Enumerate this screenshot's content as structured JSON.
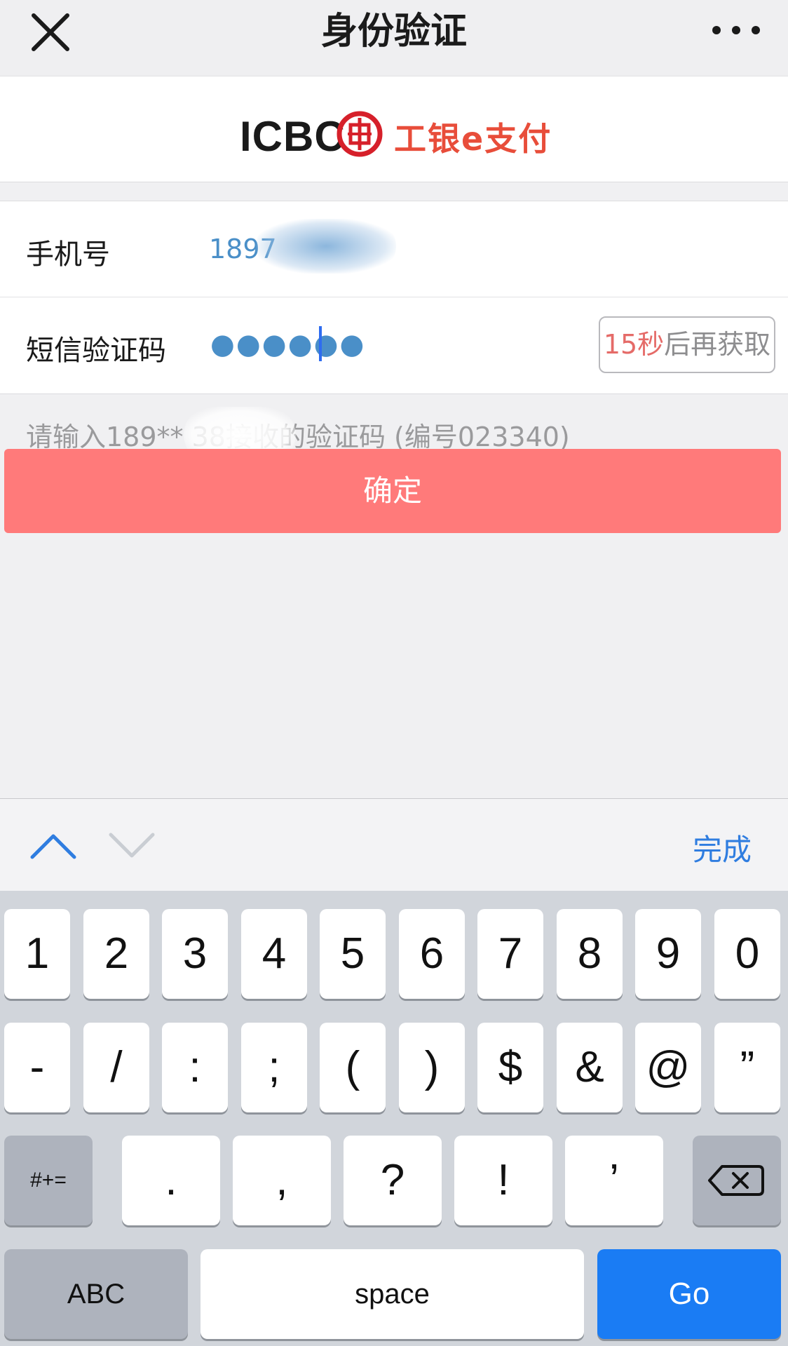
{
  "topbar": {
    "title": "身份验证"
  },
  "logo": {
    "bank": "ICBC",
    "brand": "工银e支付"
  },
  "form": {
    "phone": {
      "label": "手机号",
      "value": "1897"
    },
    "code": {
      "label": "短信验证码",
      "value": "●●●●●●",
      "resend_countdown": "15秒",
      "resend_text": "后再获取"
    },
    "hint": "请输入189**       38接收的验证码 (编号023340)"
  },
  "confirm_label": "确定",
  "accessory": {
    "done_label": "完成"
  },
  "keyboard": {
    "row1": [
      "1",
      "2",
      "3",
      "4",
      "5",
      "6",
      "7",
      "8",
      "9",
      "0"
    ],
    "row2": [
      "-",
      "/",
      ":",
      ";",
      "(",
      ")",
      "$",
      "&",
      "@",
      "”"
    ],
    "row3": [
      ".",
      ",",
      "?",
      "!",
      "’"
    ],
    "mode_label": "#+=",
    "abc_label": "ABC",
    "space_label": "space",
    "go_label": "Go"
  },
  "colors": {
    "accent_blue": "#2f7de0",
    "confirm_red": "#ff7a7a",
    "countdown_red": "#e56b68",
    "brand_red": "#e84d3a"
  }
}
